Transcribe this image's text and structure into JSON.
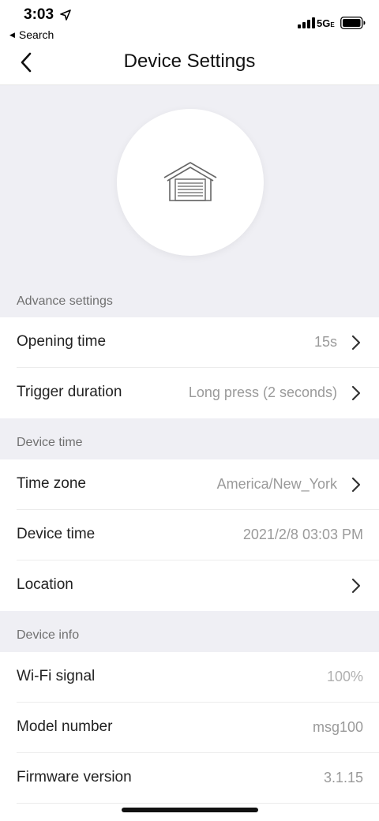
{
  "status_bar": {
    "time": "3:03",
    "back_label": "Search",
    "network": "5G",
    "network_suffix": "E"
  },
  "nav": {
    "title": "Device Settings"
  },
  "device": {
    "icon": "garage-icon"
  },
  "sections": {
    "advance": {
      "header": "Advance settings",
      "opening_time": {
        "label": "Opening time",
        "value": "15s"
      },
      "trigger_duration": {
        "label": "Trigger duration",
        "value": "Long press (2 seconds)"
      }
    },
    "device_time": {
      "header": "Device time",
      "time_zone": {
        "label": "Time zone",
        "value": "America/New_York"
      },
      "device_time": {
        "label": "Device time",
        "value": "2021/2/8 03:03 PM"
      },
      "location": {
        "label": "Location",
        "value": ""
      }
    },
    "device_info": {
      "header": "Device info",
      "wifi_signal": {
        "label": "Wi-Fi signal",
        "value": "100%"
      },
      "model_number": {
        "label": "Model number",
        "value": "msg100"
      },
      "firmware_version": {
        "label": "Firmware version",
        "value": "3.1.15"
      }
    }
  }
}
